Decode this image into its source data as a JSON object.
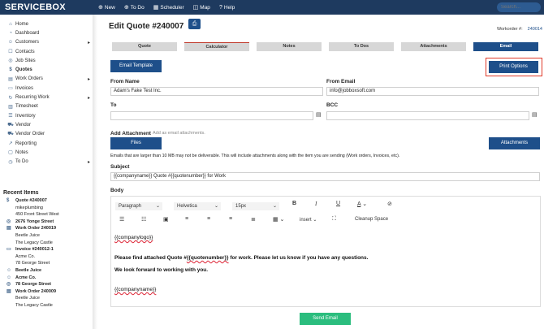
{
  "topbar": {
    "logo": "SERVICEBOX",
    "nav": [
      {
        "icon": "plus-circle-icon",
        "glyph": "⊕",
        "label": "New"
      },
      {
        "icon": "plus-circle-icon",
        "glyph": "⊕",
        "label": "To Do"
      },
      {
        "icon": "calendar-icon",
        "glyph": "▦",
        "label": "Scheduler"
      },
      {
        "icon": "map-icon",
        "glyph": "◫",
        "label": "Map"
      },
      {
        "icon": "help-icon",
        "glyph": "?",
        "label": "Help"
      }
    ],
    "search_placeholder": "Search..."
  },
  "sidebar": {
    "items": [
      {
        "icon": "home-icon",
        "glyph": "⌂",
        "label": "Home",
        "arrow": ""
      },
      {
        "icon": "dashboard-icon",
        "glyph": "◔",
        "label": "Dashboard",
        "arrow": ""
      },
      {
        "icon": "customers-icon",
        "glyph": "☺",
        "label": "Customers",
        "arrow": "▸"
      },
      {
        "icon": "contacts-icon",
        "glyph": "☐",
        "label": "Contacts",
        "arrow": ""
      },
      {
        "icon": "job-sites-icon",
        "glyph": "◎",
        "label": "Job Sites",
        "arrow": ""
      },
      {
        "icon": "quotes-icon",
        "glyph": "$",
        "label": "Quotes",
        "arrow": ""
      },
      {
        "icon": "work-orders-icon",
        "glyph": "▤",
        "label": "Work Orders",
        "arrow": "▸"
      },
      {
        "icon": "invoices-icon",
        "glyph": "▭",
        "label": "Invoices",
        "arrow": ""
      },
      {
        "icon": "recurring-icon",
        "glyph": "↻",
        "label": "Recurring Work",
        "arrow": "▸"
      },
      {
        "icon": "timesheet-icon",
        "glyph": "▥",
        "label": "Timesheet",
        "arrow": ""
      },
      {
        "icon": "inventory-icon",
        "glyph": "☰",
        "label": "Inventory",
        "arrow": ""
      },
      {
        "icon": "vendor-icon",
        "glyph": "⛟",
        "label": "Vendor",
        "arrow": ""
      },
      {
        "icon": "vendor-order-icon",
        "glyph": "⛟",
        "label": "Vendor Order",
        "arrow": ""
      },
      {
        "icon": "reporting-icon",
        "glyph": "↗",
        "label": "Reporting",
        "arrow": ""
      },
      {
        "icon": "notes-icon",
        "glyph": "▢",
        "label": "Notes",
        "arrow": ""
      },
      {
        "icon": "todo-icon",
        "glyph": "◷",
        "label": "To Do",
        "arrow": "▸"
      }
    ]
  },
  "recent": {
    "title": "Recent Items",
    "items": [
      {
        "icon": "quote-icon",
        "glyph": "$",
        "title": "Quote #240007",
        "lines": [
          "mikeplumbing",
          "450 Front Street West"
        ]
      },
      {
        "icon": "location-icon",
        "glyph": "◎",
        "title": "2676 Yonge Street",
        "lines": []
      },
      {
        "icon": "workorder-icon",
        "glyph": "▤",
        "title": "Work Order 240019",
        "lines": [
          "Beetle Juice",
          "The Legacy Castle"
        ]
      },
      {
        "icon": "invoice-icon",
        "glyph": "▭",
        "title": "Invoice #240012-1",
        "lines": [
          "Acme Co.",
          "78 George Street"
        ]
      },
      {
        "icon": "customer-icon",
        "glyph": "☺",
        "title": "Beetle Juice",
        "lines": []
      },
      {
        "icon": "customer-icon",
        "glyph": "☺",
        "title": "Acme Co.",
        "lines": []
      },
      {
        "icon": "location-icon",
        "glyph": "◎",
        "title": "78 George Street",
        "lines": []
      },
      {
        "icon": "workorder-icon",
        "glyph": "▤",
        "title": "Work Order 240009",
        "lines": [
          "Beetle Juice",
          "The Legacy Castle"
        ]
      }
    ]
  },
  "main": {
    "title": "Edit Quote #240007",
    "print_icon": "⎙",
    "workorder_label": "Workorder #:",
    "workorder_num": "240014",
    "tabs": [
      "Quote",
      "Calculator",
      "Notes",
      "To Dos",
      "Attachments",
      "Email"
    ],
    "email_template_btn": "Email Template",
    "print_options_btn": "Print Options",
    "from_name_label": "From Name",
    "from_name_value": "Adam's Fake Test Inc.",
    "from_email_label": "From Email",
    "from_email_value": "info@jobboxsoft.com",
    "to_label": "To",
    "to_value": "",
    "bcc_label": "BCC",
    "bcc_value": "",
    "add_attachment_label": "Add Attachment",
    "add_attachment_hint": "Add as email attachments.",
    "files_btn": "Files",
    "attachments_btn": "Attachments",
    "size_warning": "Emails that are larger than 10 MB may not be deliverable. This will include attachments along with the item you are sending (Work orders, Invoices, etc).",
    "subject_label": "Subject",
    "subject_value": "{{companyname}} Quote #{{quotenumber}} for Work",
    "body_label": "Body",
    "editor": {
      "paragraph": "Paragraph",
      "font": "Helvetica",
      "size": "15px",
      "insert": "insert",
      "cleanup": "Cleanup Space",
      "content": {
        "logo_placeholder": "{{companylogo}}",
        "line1_pre": "Please find attached Quote #",
        "line1_ph": "{{quotenumber}}",
        "line1_post": " for work. Please let us know if you have any questions.",
        "line2": "We look forward to working with you.",
        "name_placeholder": "{{companyname}}"
      }
    },
    "send_btn": "Send Email"
  }
}
